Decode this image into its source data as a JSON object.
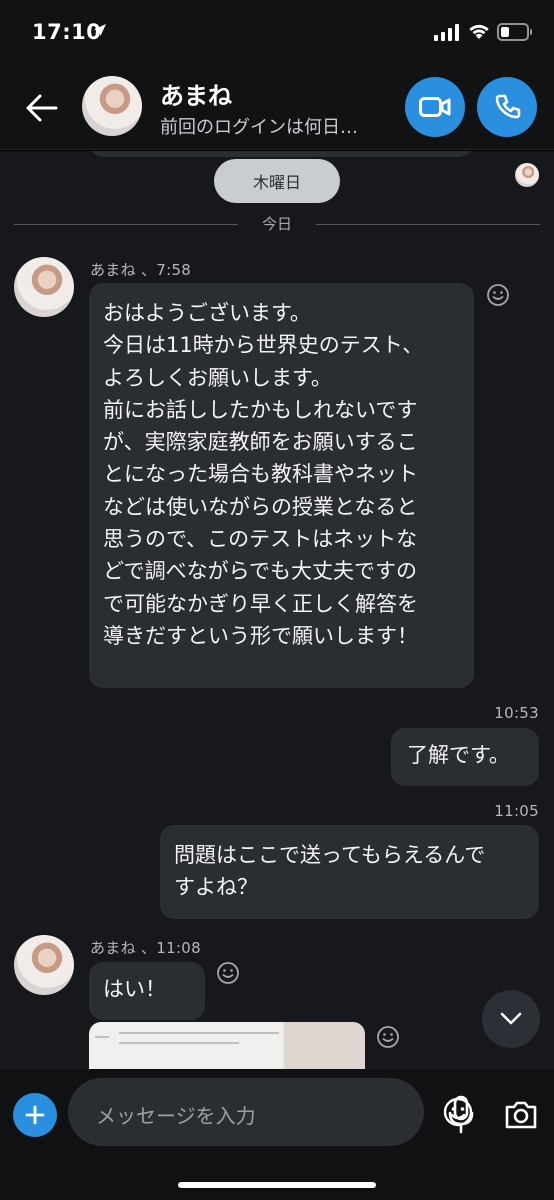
{
  "status_bar": {
    "time": "17:10",
    "location_icon": "location-arrow-icon",
    "signal_icon": "cellular-signal-icon",
    "wifi_icon": "wifi-icon",
    "battery_icon": "battery-icon"
  },
  "header": {
    "back_icon": "back-arrow-icon",
    "contact_name": "あまね",
    "contact_status": "前回のログインは何日…",
    "video_icon": "video-camera-icon",
    "call_icon": "phone-icon",
    "accent_color": "#2b8fdf"
  },
  "chat": {
    "day_pill": "木曜日",
    "divider_label": "今日",
    "messages": [
      {
        "sender": "あまね",
        "meta": "あまね 、7:58",
        "text": "おはようございます。\n今日は11時から世界史のテスト、\nよろしくお願いします。\n前にお話ししたかもしれないです\nが、実際家庭教師をお願いするこ\nとになった場合も教科書やネット\nなどは使いながらの授業となると\n思うので、このテストはネットな\nどで調べながらでも大丈夫ですの\nで可能なかぎり早く正しく解答を\n導きだすという形で願いします！"
      },
      {
        "sender": "me",
        "time": "10:53",
        "text": "了解です。"
      },
      {
        "sender": "me",
        "time": "11:05",
        "text": "問題はここで送ってもらえるんで\nすよね？"
      },
      {
        "sender": "あまね",
        "meta": "あまね 、11:08",
        "text": "はい！"
      }
    ],
    "reaction_icon": "smiley-reaction-icon",
    "scroll_icon": "chevron-down-icon"
  },
  "composer": {
    "placeholder": "メッセージを入力",
    "plus_icon": "plus-icon",
    "emoji_icon": "emoji-icon",
    "mic_icon": "microphone-icon",
    "camera_icon": "camera-icon"
  }
}
